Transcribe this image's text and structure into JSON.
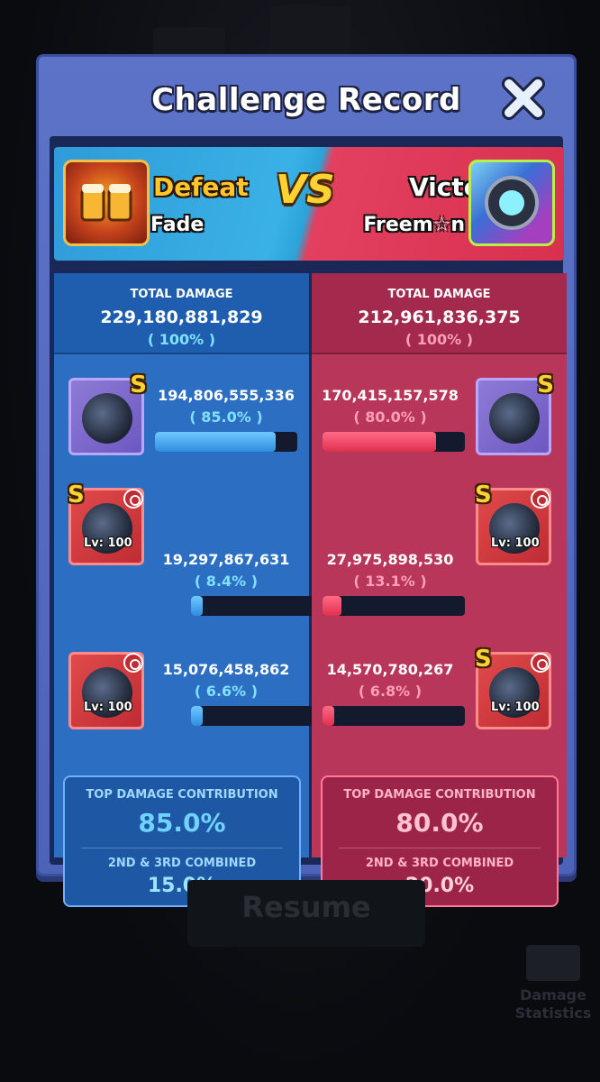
{
  "modal": {
    "title": "Challenge Record",
    "close_icon": "close-x-icon"
  },
  "banner": {
    "left": {
      "result": "Defeat",
      "name": "Fade",
      "result_color": "#ffc629"
    },
    "vs": "VS",
    "right": {
      "result": "Victory",
      "name": "Freem☆n",
      "result_color": "#ffffff"
    }
  },
  "teams": [
    {
      "side": "left",
      "total_label": "TOTAL DAMAGE",
      "total_value": "229,180,881,829",
      "total_pct": "( 100% )",
      "units": [
        {
          "rank": "S",
          "level": "",
          "damage": "194,806,555,336",
          "pct": "( 85.0% )",
          "fill": 0.85,
          "frame": "purple"
        },
        {
          "rank": "S",
          "level": "Lv: 100",
          "damage": "19,297,867,631",
          "pct": "( 8.4% )",
          "fill": 0.084,
          "frame": "red"
        },
        {
          "rank": "",
          "level": "Lv: 100",
          "damage": "15,076,458,862",
          "pct": "( 6.6% )",
          "fill": 0.066,
          "frame": "red"
        }
      ],
      "top_label": "TOP DAMAGE CONTRIBUTION",
      "top_value": "85.0%",
      "combined_label": "2ND & 3RD COMBINED",
      "combined_value": "15.0%"
    },
    {
      "side": "right",
      "total_label": "TOTAL DAMAGE",
      "total_value": "212,961,836,375",
      "total_pct": "( 100% )",
      "units": [
        {
          "rank": "S",
          "level": "",
          "damage": "170,415,157,578",
          "pct": "( 80.0% )",
          "fill": 0.8,
          "frame": "purple"
        },
        {
          "rank": "S",
          "level": "Lv: 100",
          "damage": "27,975,898,530",
          "pct": "( 13.1% )",
          "fill": 0.131,
          "frame": "red"
        },
        {
          "rank": "S",
          "level": "Lv: 100",
          "damage": "14,570,780,267",
          "pct": "( 6.8% )",
          "fill": 0.068,
          "frame": "red"
        }
      ],
      "top_label": "TOP DAMAGE CONTRIBUTION",
      "top_value": "80.0%",
      "combined_label": "2ND & 3RD COMBINED",
      "combined_value": "20.0%"
    }
  ],
  "resume_button": "Resume",
  "damage_stats": {
    "line1": "Damage",
    "line2": "Statistics"
  },
  "colors": {
    "modal": "#5d73c8",
    "blue_team": "#2c6fc2",
    "red_team": "#b8365a",
    "accent_gold": "#ffd233"
  }
}
